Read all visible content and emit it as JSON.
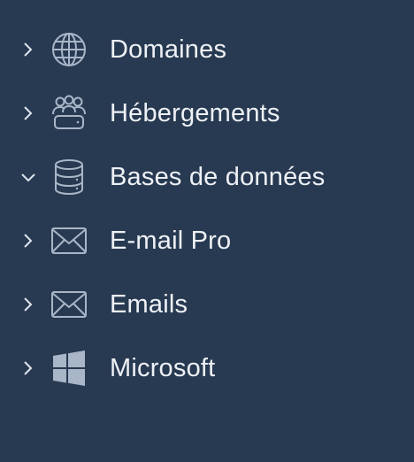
{
  "sidebar": {
    "items": [
      {
        "label": "Domaines",
        "icon": "globe-icon",
        "expanded": false
      },
      {
        "label": "Hébergements",
        "icon": "users-server-icon",
        "expanded": false
      },
      {
        "label": "Bases de données",
        "icon": "database-icon",
        "expanded": true
      },
      {
        "label": "E-mail Pro",
        "icon": "envelope-icon",
        "expanded": false
      },
      {
        "label": "Emails",
        "icon": "envelope-icon",
        "expanded": false
      },
      {
        "label": "Microsoft",
        "icon": "windows-logo-icon",
        "expanded": false
      }
    ]
  },
  "colors": {
    "background": "#283a52",
    "text": "#eef1f5",
    "icon": "#a9b6c8"
  }
}
